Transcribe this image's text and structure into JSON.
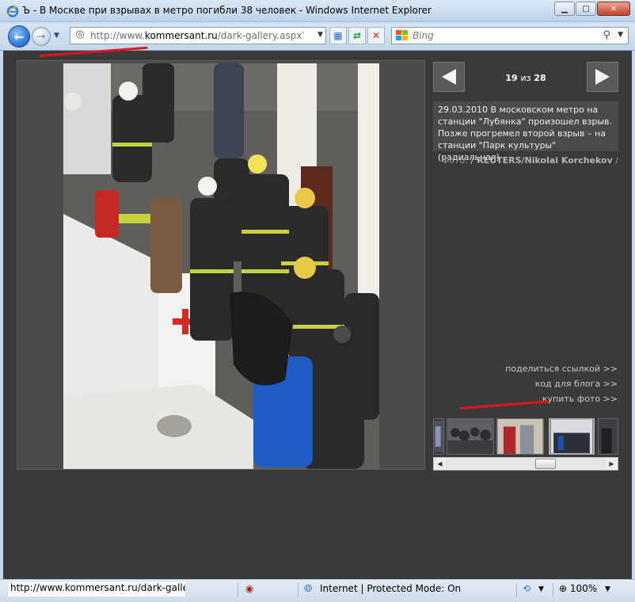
{
  "window": {
    "title": "Ъ - В Москве при взрывах в метро погибли 38 человек - Windows Internet Explorer"
  },
  "address": {
    "url_prefix": "http://www.",
    "url_domain": "kommersant.ru",
    "url_path": "/dark-gallery.aspx?PicsID"
  },
  "search": {
    "placeholder": "Bing"
  },
  "gallery": {
    "current": "19",
    "separator": "из",
    "total": "28",
    "caption": "29.03.2010 В московском метро на станции \"Лубянка\" произошел взрыв. Позже прогремел второй взрыв – на станции \"Парк культуры\" (радиальная)",
    "credit_label": "Фото:",
    "credit_name": "/ REUTERS/Nikolai Korchekov",
    "credit_suffix": "/"
  },
  "links": {
    "share": "поделиться ссылкой >>",
    "blog_code": "код для блога >>",
    "buy_photo": "купить фото >>"
  },
  "status": {
    "url": "http://www.kommersant.ru/dark-gallery.a",
    "zone": "Internet | Protected Mode: On",
    "zoom": "100%"
  },
  "colors": {
    "annotation_red": "#e2151b",
    "page_bg": "#3a3a3a"
  }
}
